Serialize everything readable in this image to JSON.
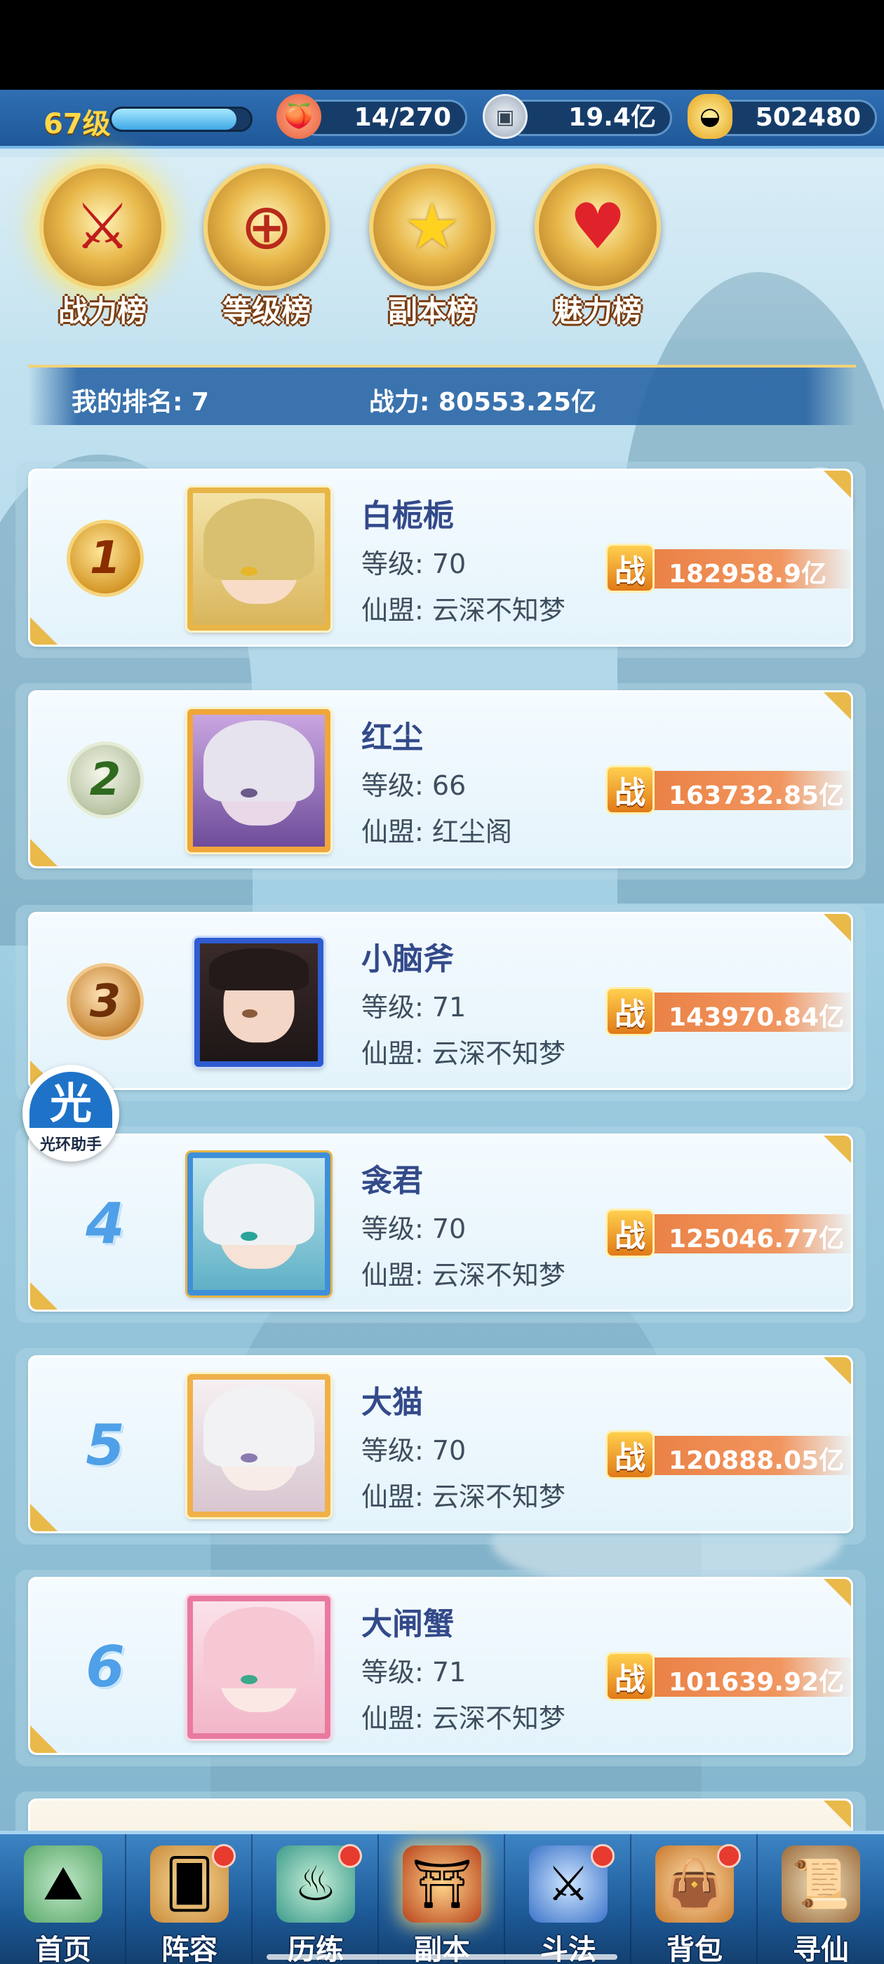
{
  "resources": {
    "level": "67级",
    "exp_fraction": 0.9,
    "stamina": "14/270",
    "silver": "19.4亿",
    "gold": "502480"
  },
  "tabs": [
    {
      "label": "战力榜",
      "icon": "sword-emblem-icon",
      "active": true
    },
    {
      "label": "等级榜",
      "icon": "drum-emblem-icon",
      "active": false
    },
    {
      "label": "副本榜",
      "icon": "star-emblem-icon",
      "active": false
    },
    {
      "label": "魅力榜",
      "icon": "heart-emblem-icon",
      "active": false
    }
  ],
  "my_rank": {
    "rank_text": "我的排名: 7",
    "power_text": "战力: 80553.25亿"
  },
  "rows": [
    {
      "rank": "1",
      "name": "白栀栀",
      "level": "等级: 70",
      "guild": "仙盟: 云深不知梦",
      "power": "182958.9亿"
    },
    {
      "rank": "2",
      "name": "红尘",
      "level": "等级: 66",
      "guild": "仙盟: 红尘阁",
      "power": "163732.85亿"
    },
    {
      "rank": "3",
      "name": "小脑斧",
      "level": "等级: 71",
      "guild": "仙盟: 云深不知梦",
      "power": "143970.84亿"
    },
    {
      "rank": "4",
      "name": "衾君",
      "level": "等级: 70",
      "guild": "仙盟: 云深不知梦",
      "power": "125046.77亿"
    },
    {
      "rank": "5",
      "name": "大猫",
      "level": "等级: 70",
      "guild": "仙盟: 云深不知梦",
      "power": "120888.05亿"
    },
    {
      "rank": "6",
      "name": "大闸蟹",
      "level": "等级: 71",
      "guild": "仙盟: 云深不知梦",
      "power": "101639.92亿"
    }
  ],
  "power_badge_label": "战",
  "helper": {
    "glyph": "光",
    "label": "光环助手"
  },
  "bottom_nav": [
    {
      "label": "首页",
      "badge": false
    },
    {
      "label": "阵容",
      "badge": true
    },
    {
      "label": "历练",
      "badge": true
    },
    {
      "label": "副本",
      "badge": false
    },
    {
      "label": "斗法",
      "badge": true
    },
    {
      "label": "背包",
      "badge": true
    },
    {
      "label": "寻仙",
      "badge": false
    }
  ],
  "colors": {
    "accent_blue": "#1f5898",
    "gold": "#e9b94a",
    "power_orange": "#e87a3c",
    "name_blue": "#334a8a"
  }
}
